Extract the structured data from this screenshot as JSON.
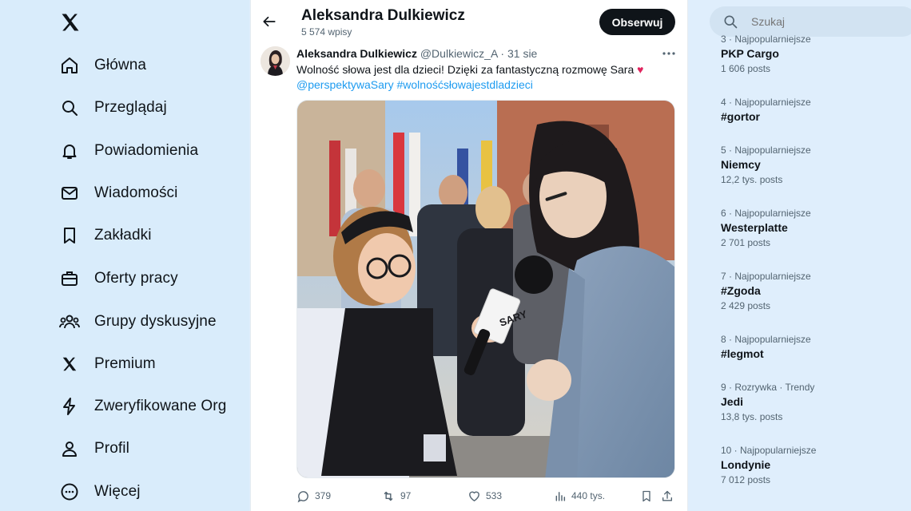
{
  "nav": {
    "items": [
      {
        "label": "Główna"
      },
      {
        "label": "Przeglądaj"
      },
      {
        "label": "Powiadomienia"
      },
      {
        "label": "Wiadomości"
      },
      {
        "label": "Zakładki"
      },
      {
        "label": "Oferty pracy"
      },
      {
        "label": "Grupy dyskusyjne"
      },
      {
        "label": "Premium"
      },
      {
        "label": "Zweryfikowane Org"
      },
      {
        "label": "Profil"
      },
      {
        "label": "Więcej"
      }
    ]
  },
  "header": {
    "title": "Aleksandra Dulkiewicz",
    "posts_count": "5 574 wpisy",
    "follow_label": "Obserwuj"
  },
  "tweet": {
    "name": "Aleksandra Dulkiewicz",
    "handle": "@Dulkiewicz_A",
    "dot": "·",
    "date": "31 sie",
    "text_main": "Wolność słowa jest dla dzieci! Dzięki za fantastyczną rozmowę Sara",
    "heart": "♥",
    "mention": "@perspektywaSary",
    "hashtag": "#wolnośćsłowajestdladzieci",
    "mic_text": "SARY",
    "stats": {
      "replies": "379",
      "reposts": "97",
      "likes": "533",
      "views": "440 tys."
    }
  },
  "search": {
    "placeholder": "Szukaj"
  },
  "trends": [
    {
      "meta": "3 · Najpopularniejsze",
      "name": "PKP Cargo",
      "count": "1 606 posts"
    },
    {
      "meta": "4 · Najpopularniejsze",
      "name": "#gortor",
      "count": ""
    },
    {
      "meta": "5 · Najpopularniejsze",
      "name": "Niemcy",
      "count": "12,2 tys. posts"
    },
    {
      "meta": "6 · Najpopularniejsze",
      "name": "Westerplatte",
      "count": "2 701 posts"
    },
    {
      "meta": "7 · Najpopularniejsze",
      "name": "#Zgoda",
      "count": "2 429 posts"
    },
    {
      "meta": "8 · Najpopularniejsze",
      "name": "#legmot",
      "count": ""
    },
    {
      "meta": "9 · Rozrywka · Trendy",
      "name": "Jedi",
      "count": "13,8 tys. posts"
    },
    {
      "meta": "10 · Najpopularniejsze",
      "name": "Londynie",
      "count": "7 012 posts"
    }
  ],
  "colors": {
    "accent": "#1d9bf0",
    "text": "#0f1419",
    "muted": "#536471",
    "heart": "#e0245e"
  }
}
